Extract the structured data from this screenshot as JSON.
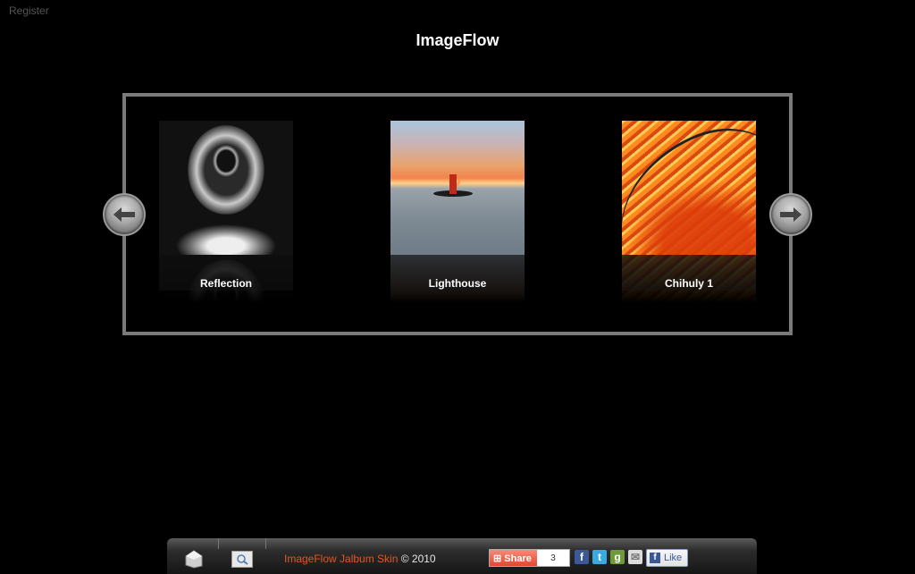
{
  "header": {
    "register_label": "Register",
    "title": "ImageFlow"
  },
  "gallery": {
    "items": [
      {
        "caption": "Reflection"
      },
      {
        "caption": "Lighthouse"
      },
      {
        "caption": "Chihuly 1"
      }
    ],
    "prev_icon": "arrow-left-icon",
    "next_icon": "arrow-right-icon"
  },
  "footer": {
    "home_icon": "home-icon",
    "search_icon": "search-icon",
    "skin_link": "ImageFlow Jalbum Skin",
    "copyright": "© 2010",
    "share_label": "Share",
    "share_count": "3",
    "social_icons": [
      "facebook-icon",
      "twitter-icon",
      "google-icon",
      "email-icon"
    ],
    "like_label": "Like",
    "accent": "#e8541e"
  }
}
